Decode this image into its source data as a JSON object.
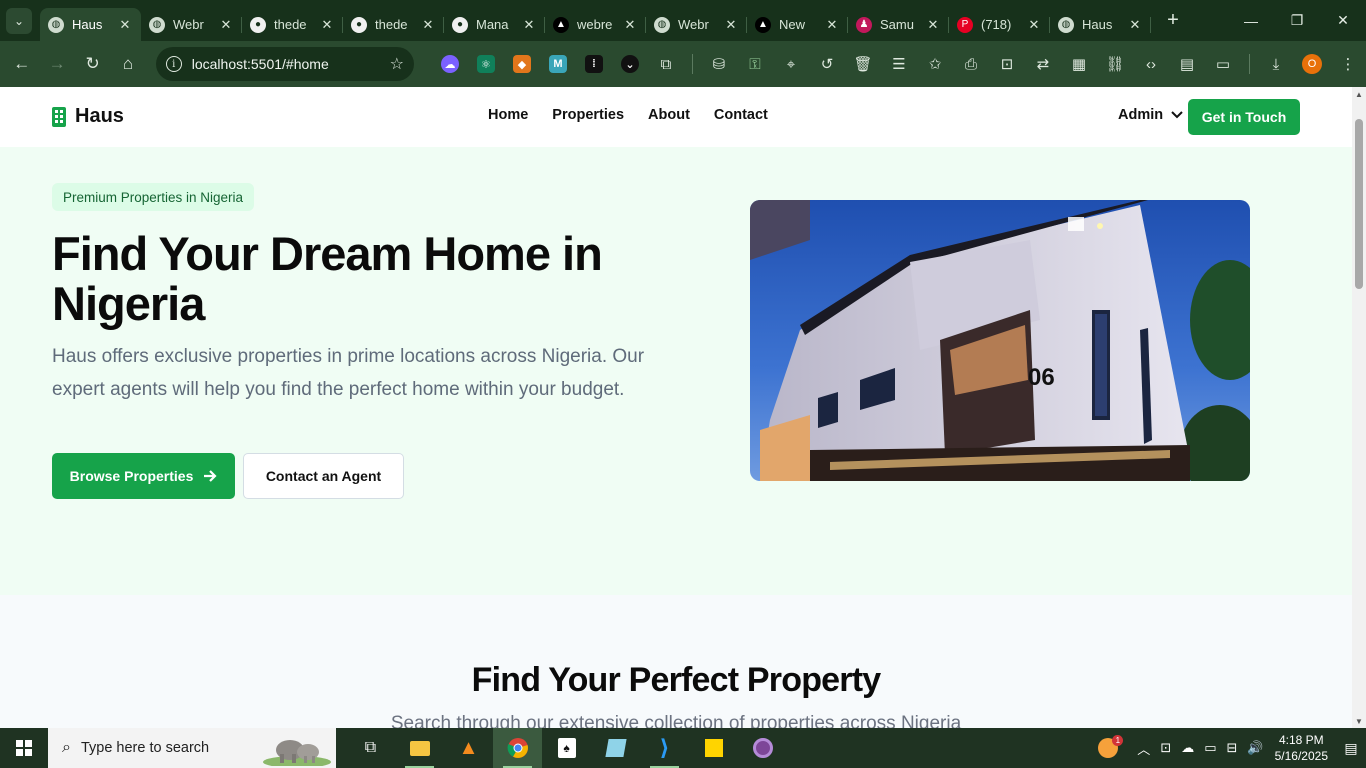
{
  "browser": {
    "tabs": [
      {
        "title": "Haus",
        "favicon": "globe-icon",
        "active": true
      },
      {
        "title": "Webr",
        "favicon": "globe-icon"
      },
      {
        "title": "thede",
        "favicon": "github-icon"
      },
      {
        "title": "thede",
        "favicon": "github-icon"
      },
      {
        "title": "Mana",
        "favicon": "github-icon"
      },
      {
        "title": "webre",
        "favicon": "triangle-icon"
      },
      {
        "title": "Webr",
        "favicon": "globe-icon"
      },
      {
        "title": "New",
        "favicon": "triangle-icon"
      },
      {
        "title": "Samu",
        "favicon": "person-icon"
      },
      {
        "title": "(718)",
        "favicon": "pinterest-icon"
      },
      {
        "title": "Haus",
        "favicon": "globe-icon"
      }
    ],
    "url": "localhost:5501/#home",
    "profile_initial": "O"
  },
  "site": {
    "brand": "Haus",
    "nav": [
      "Home",
      "Properties",
      "About",
      "Contact"
    ],
    "admin_label": "Admin",
    "cta_label": "Get in Touch"
  },
  "hero": {
    "badge": "Premium Properties in Nigeria",
    "title": "Find Your Dream Home in Nigeria",
    "description": "Haus offers exclusive properties in prime locations across Nigeria. Our expert agents will help you find the perfect home within your budget.",
    "primary_button": "Browse Properties",
    "secondary_button": "Contact an Agent",
    "image_house_number": "06"
  },
  "search_section": {
    "title": "Find Your Perfect Property",
    "subtitle": "Search through our extensive collection of properties across Nigeria"
  },
  "taskbar": {
    "search_placeholder": "Type here to search",
    "time": "4:18 PM",
    "date": "5/16/2025",
    "weather_badge": "1"
  },
  "colors": {
    "accent": "#16a34a",
    "hero_bg": "#f0fdf4",
    "chrome_dark": "#17311b",
    "chrome_toolbar": "#2a4a2f"
  }
}
